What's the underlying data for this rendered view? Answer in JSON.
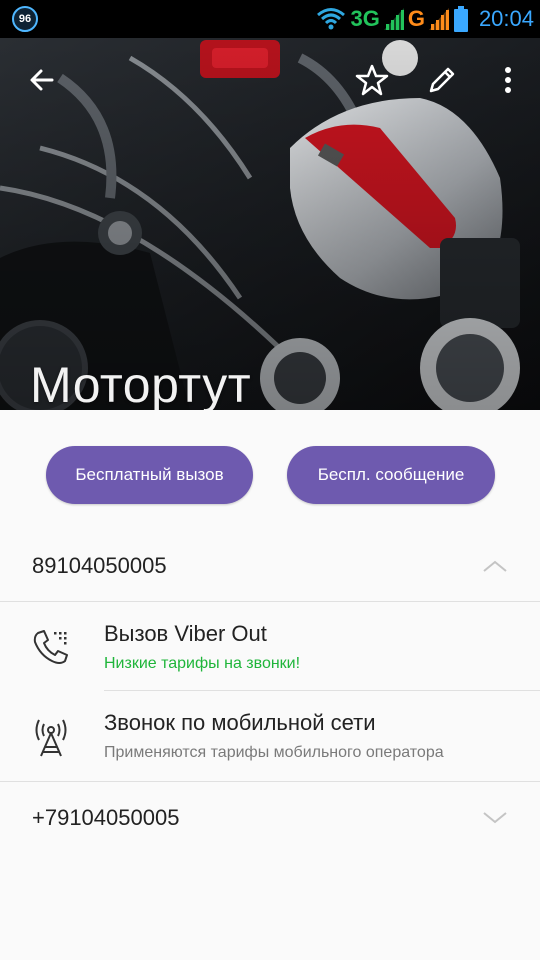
{
  "status_bar": {
    "badge": "96",
    "network_3g": "3G",
    "network_g": "G",
    "time": "20:04"
  },
  "header": {
    "back_icon": "arrow-left-icon",
    "favorite_icon": "star-outline-icon",
    "edit_icon": "pencil-icon",
    "menu_icon": "more-vertical-icon"
  },
  "contact": {
    "name": "Мотортут"
  },
  "actions": {
    "free_call": "Бесплатный вызов",
    "free_message": "Беспл. сообщение"
  },
  "numbers": [
    {
      "number": "89104050005",
      "expanded": true,
      "options": [
        {
          "title": "Вызов Viber Out",
          "subtitle": "Низкие тарифы на звонки!",
          "icon": "phone-viber-out-icon"
        },
        {
          "title": "Звонок по мобильной сети",
          "subtitle": "Применяются тарифы мобильного оператора",
          "icon": "cell-tower-icon"
        }
      ]
    },
    {
      "number": "+79104050005",
      "expanded": false
    }
  ],
  "colors": {
    "accent": "#6e5aaf",
    "green": "#1fb53a",
    "status_blue": "#3aa8ff"
  }
}
